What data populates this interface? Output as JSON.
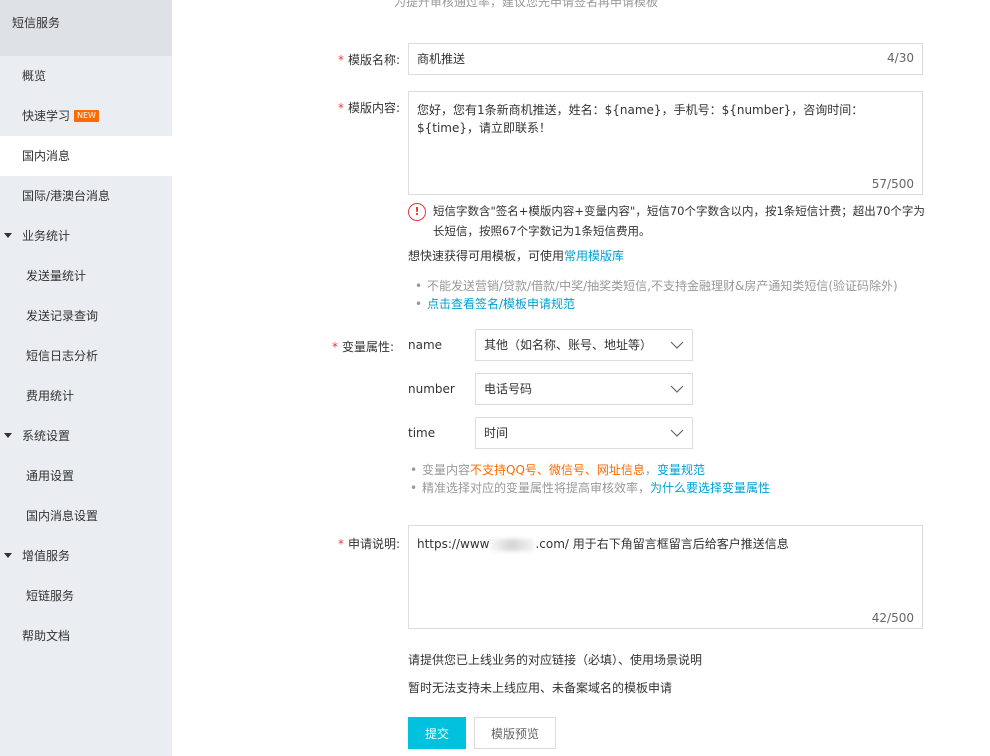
{
  "sidebar": {
    "title": "短信服务",
    "items": [
      {
        "label": "概览"
      },
      {
        "label": "快速学习",
        "badge": "NEW"
      },
      {
        "label": "国内消息"
      },
      {
        "label": "国际/港澳台消息"
      }
    ],
    "groups": [
      {
        "label": "业务统计",
        "children": [
          "发送量统计",
          "发送记录查询",
          "短信日志分析",
          "费用统计"
        ]
      },
      {
        "label": "系统设置",
        "children": [
          "通用设置",
          "国内消息设置"
        ]
      },
      {
        "label": "增值服务",
        "children": [
          "短链服务"
        ]
      }
    ],
    "help": "帮助文档",
    "active_item": "国内消息"
  },
  "form": {
    "top_tip": "为提升审核通过率，建议您先申请签名再申请模板",
    "template_name": {
      "label": "模版名称:",
      "value": "商机推送",
      "counter": "4/30"
    },
    "template_content": {
      "label": "模版内容:",
      "value": "您好，您有1条新商机推送，姓名：${name}，手机号：${number}，咨询时间：${time}，请立即联系！",
      "counter": "57/500"
    },
    "warning": {
      "icon": "warning-circle-icon",
      "text": "短信字数含\"签名+模版内容+变量内容\"，短信70个字数含以内，按1条短信计费；超出70个字为长短信，按照67个字数记为1条短信费用。"
    },
    "quick_tip": {
      "prefix": "想快速获得可用模板，可使用",
      "link": "常用模版库"
    },
    "rules": [
      {
        "text": "不能发送营销/贷款/借款/中奖/抽奖类短信,不支持金融理财&房产通知类短信(验证码除外)",
        "type": "grey"
      },
      {
        "text": "点击查看签名/模板申请规范",
        "type": "link"
      }
    ],
    "variables": {
      "label": "变量属性:",
      "rows": [
        {
          "name": "name",
          "value": "其他（如名称、账号、地址等）"
        },
        {
          "name": "number",
          "value": "电话号码"
        },
        {
          "name": "time",
          "value": "时间"
        }
      ],
      "tips": {
        "line1_prefix": "变量内容",
        "line1_warn": "不支持QQ号、微信号、网址信息",
        "line1_sep": "，",
        "line1_link": "变量规范",
        "line2_prefix": "精准选择对应的变量属性将提高审核效率，",
        "line2_link": "为什么要选择变量属性"
      }
    },
    "apply_desc": {
      "label": "申请说明:",
      "value_prefix": "https://www",
      "value_suffix": ".com/ 用于右下角留言框留言后给客户推送信息",
      "counter": "42/500"
    },
    "hint1": "请提供您已上线业务的对应链接（必填）、使用场景说明",
    "hint2": "暂时无法支持未上线应用、未备案域名的模板申请",
    "submit_label": "提交",
    "preview_label": "模版预览"
  },
  "colors": {
    "accent": "#00c1de",
    "link": "#00a0d2",
    "required": "#e4393c",
    "orange": "#ff6a00",
    "sidebar_bg": "#eaedf1"
  }
}
